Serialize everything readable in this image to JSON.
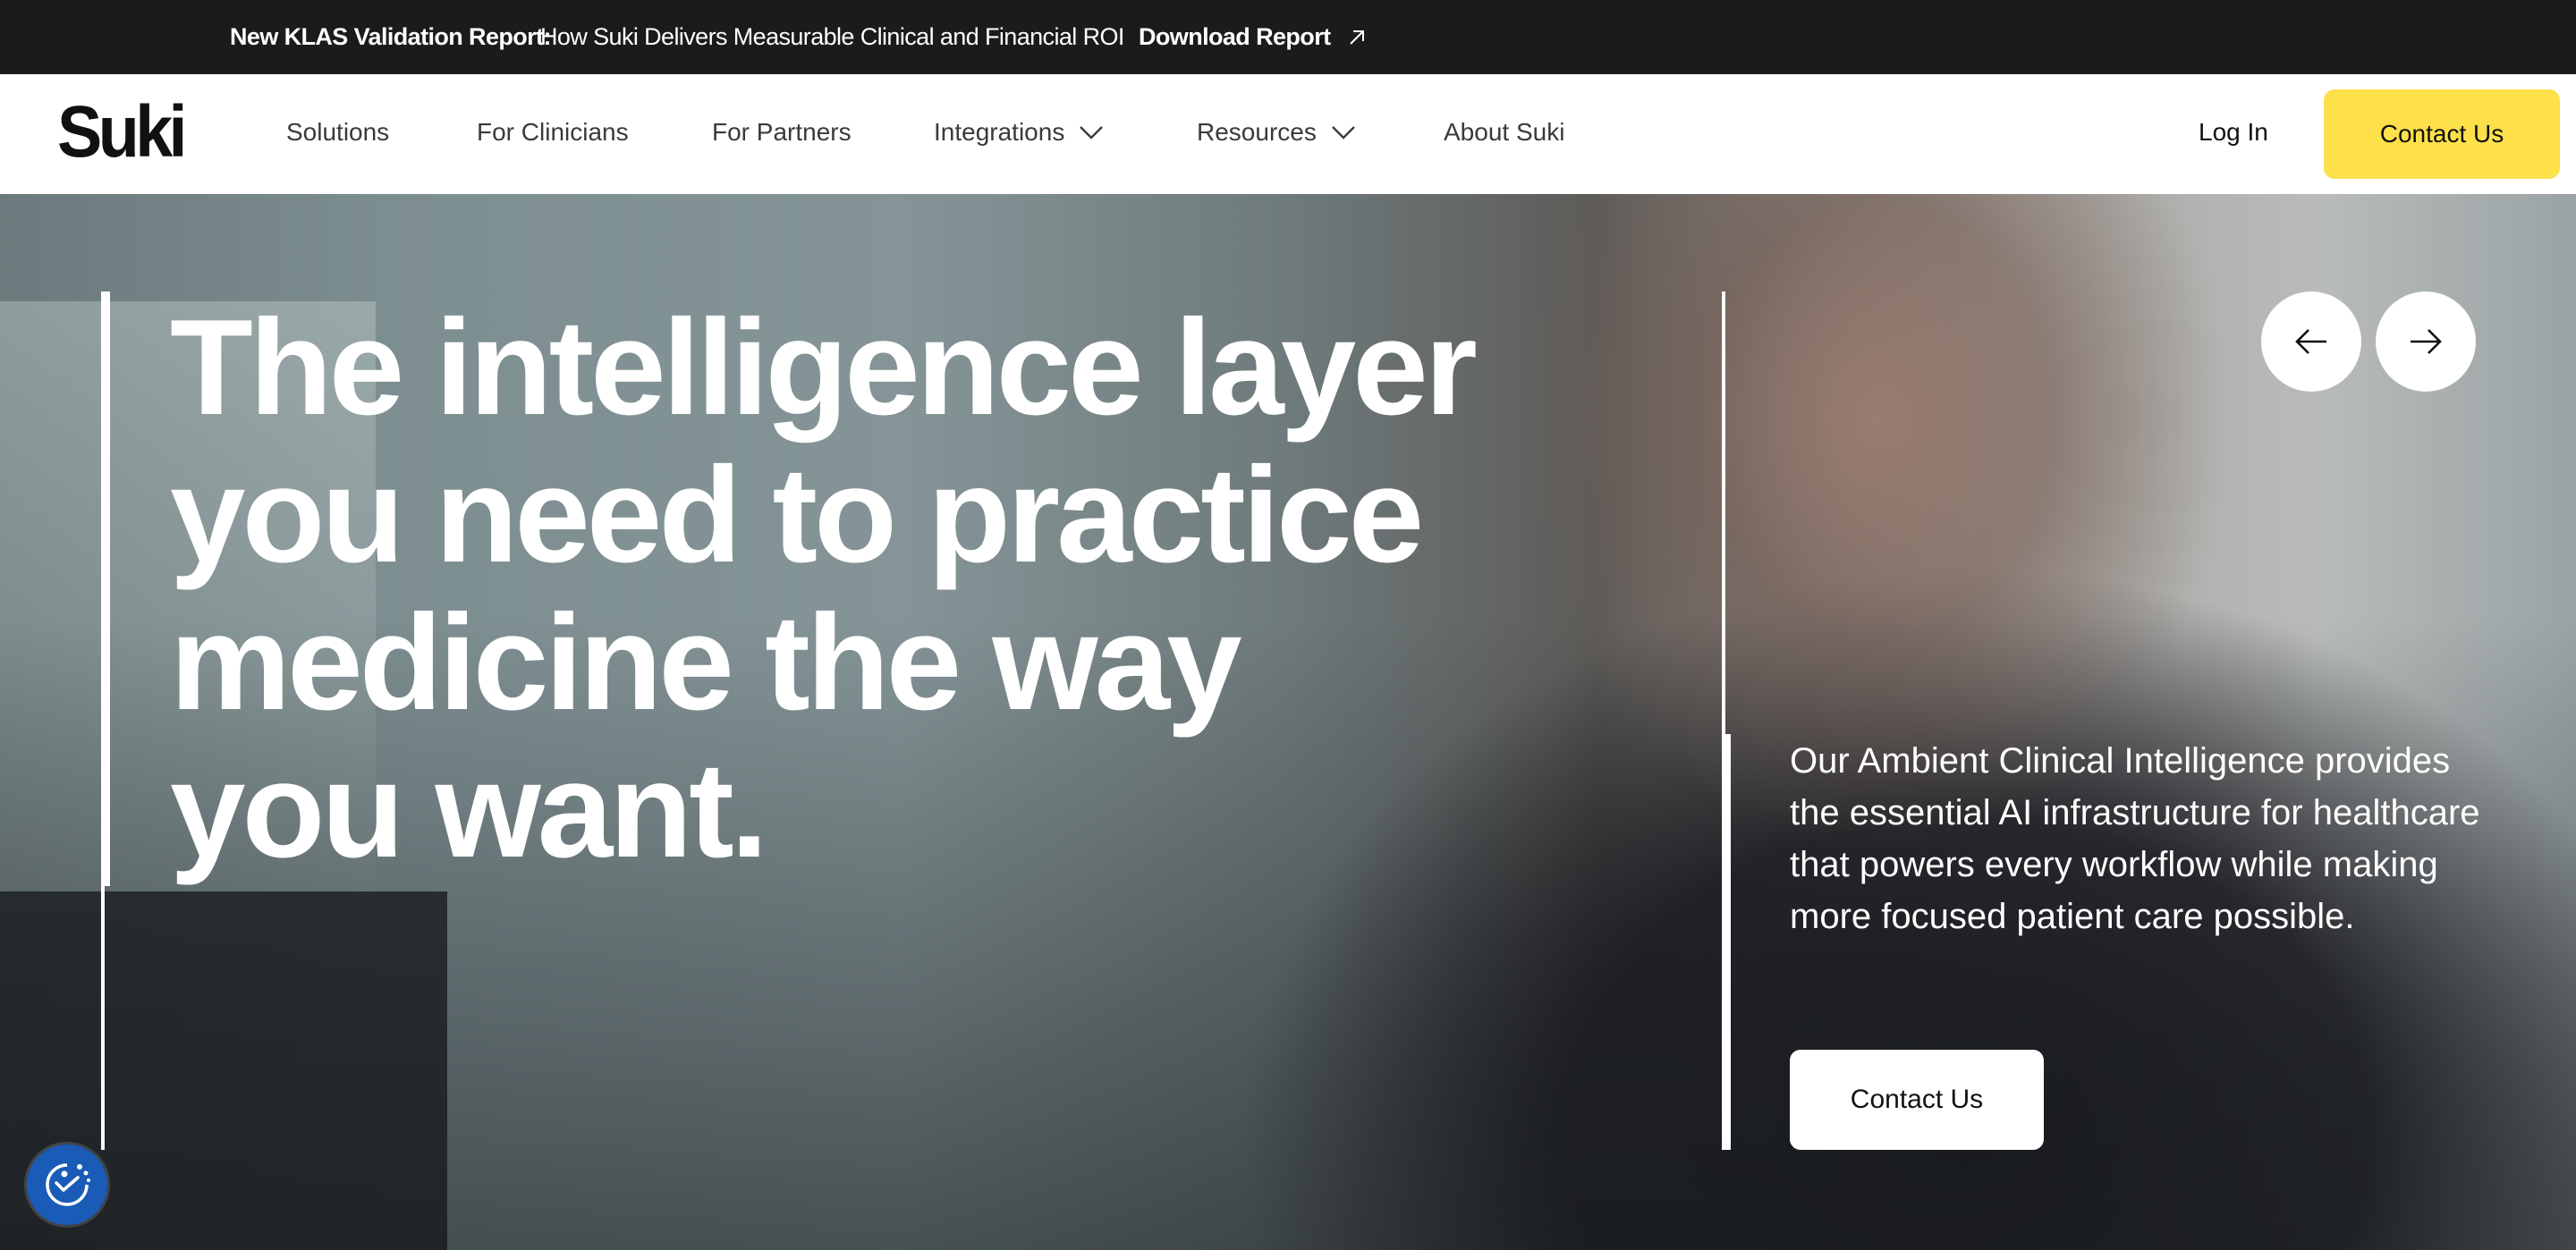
{
  "announcement": {
    "lead": "New KLAS Validation Report:",
    "message": "How Suki Delivers Measurable Clinical and Financial ROI",
    "link_label": "Download Report",
    "link_icon": "arrow-up-right-icon"
  },
  "nav": {
    "logo": "Suki",
    "items": [
      {
        "label": "Solutions"
      },
      {
        "label": "For Clinicians"
      },
      {
        "label": "For Partners"
      },
      {
        "label": "Integrations",
        "icon": "chevron-down-icon"
      },
      {
        "label": "Resources",
        "icon": "chevron-down-icon"
      },
      {
        "label": "About Suki"
      }
    ],
    "login_label": "Log In",
    "cta_label": "Contact Us"
  },
  "hero": {
    "headline_lines": [
      "The intelligence layer",
      "you need to practice",
      "medicine the way",
      "you want."
    ],
    "subcopy": "Our Ambient Clinical Intelligence provides the essential AI infrastructure for healthcare that powers every workflow while making more focused patient care possible.",
    "cta_label": "Contact Us",
    "prev_icon": "arrow-left-icon",
    "next_icon": "arrow-right-icon"
  },
  "accessibility_widget": {
    "icon": "accessibility-icon"
  },
  "colors": {
    "announcement_bg": "#1b1b1b",
    "accent": "#fde04a",
    "a11y_blue": "#1a5bb8"
  }
}
